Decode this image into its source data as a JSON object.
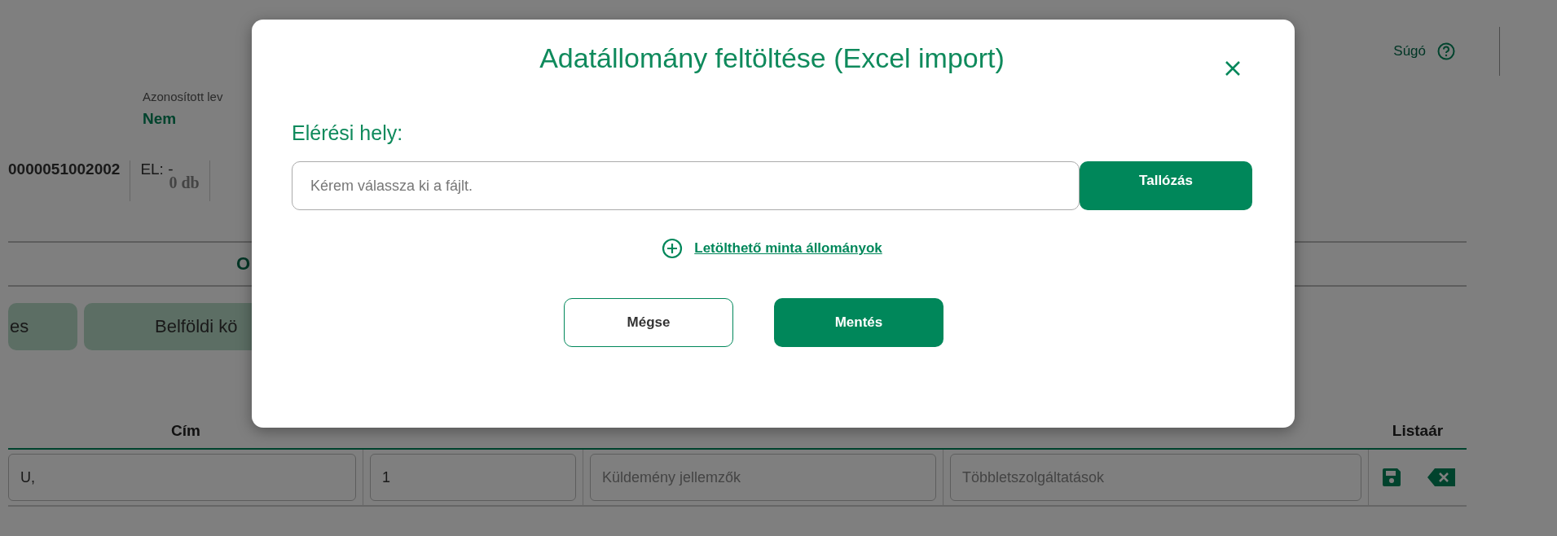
{
  "background": {
    "help_link": "Súgó",
    "identified_label": "Azonosított lev",
    "identified_value": "Nem",
    "shipment_id": "0000051002002",
    "el_label": "EL: -",
    "el_count": "0 db",
    "section_letter": "O",
    "tabs": [
      {
        "label": "es"
      },
      {
        "label": "Belföldi kö"
      }
    ],
    "table": {
      "columns": [
        {
          "label": "Cím"
        },
        {
          "label": "Listaár"
        }
      ],
      "cells": [
        {
          "value": "U,"
        },
        {
          "value": "1"
        },
        {
          "placeholder": "Küldemény jellemzők"
        },
        {
          "placeholder": "Többletszolgáltatások"
        }
      ]
    }
  },
  "dialog": {
    "title": "Adatállomány feltöltése (Excel import)",
    "path_label": "Elérési hely:",
    "file_field": {
      "placeholder": "Kérem válassza ki a fájlt."
    },
    "browse_button": "Tallózás",
    "sample_link": "Letölthető minta állományok",
    "buttons": [
      {
        "label": "Mégse",
        "kind": "secondary"
      },
      {
        "label": "Mentés",
        "kind": "primary"
      }
    ]
  }
}
